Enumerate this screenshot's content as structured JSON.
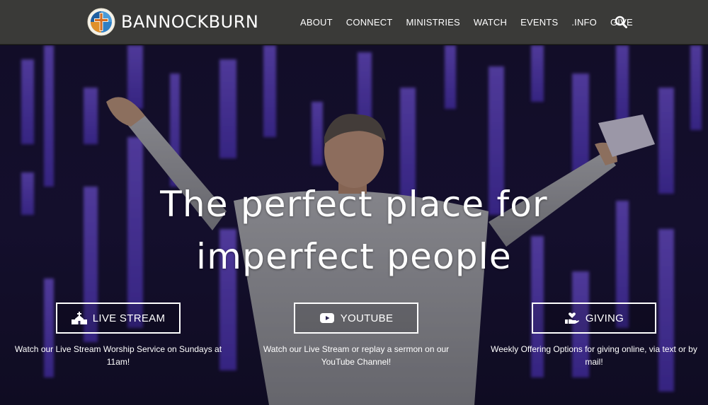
{
  "header": {
    "brand": "BANNOCKBURN",
    "nav": [
      "ABOUT",
      "CONNECT",
      "MINISTRIES",
      "WATCH",
      "EVENTS",
      ".INFO",
      "GIVE"
    ]
  },
  "hero": {
    "headline_line1": "The perfect place for",
    "headline_line2": "imperfect people"
  },
  "cards": [
    {
      "label": "LIVE STREAM",
      "icon": "church-icon",
      "description": "Watch our Live Stream Worship Service on Sundays at 11am!"
    },
    {
      "label": "YOUTUBE",
      "icon": "youtube-icon",
      "description": "Watch our Live Stream or replay a sermon on our YouTube Channel!"
    },
    {
      "label": "GIVING",
      "icon": "hand-heart-icon",
      "description": "Weekly Offering Options for giving online, via text or by mail!"
    }
  ],
  "colors": {
    "header_bg": "#3a3a38",
    "stage_purple": "#5b3fd6",
    "text": "#ffffff"
  }
}
